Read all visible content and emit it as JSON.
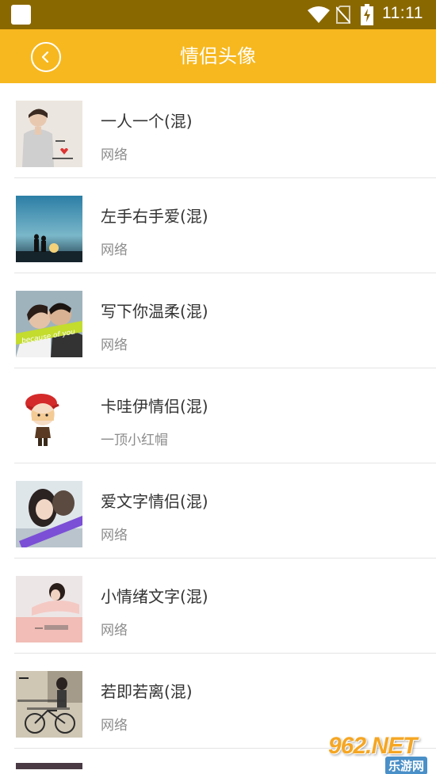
{
  "status_bar": {
    "time": "11:11",
    "icons": [
      "app-notification-icon",
      "wifi-icon",
      "no-sim-icon",
      "battery-charging-icon"
    ]
  },
  "header": {
    "title": "情侣头像",
    "back_icon": "chevron-left-icon",
    "background_color": "#f7b81f"
  },
  "list": {
    "items": [
      {
        "title": "一人一个(混)",
        "subtitle": "网络",
        "thumb": "thumb-boy-portrait"
      },
      {
        "title": "左手右手爱(混)",
        "subtitle": "网络",
        "thumb": "thumb-couple-sunset"
      },
      {
        "title": "写下你温柔(混)",
        "subtitle": "网络",
        "thumb": "thumb-couple-kiss",
        "thumb_text": "because of you"
      },
      {
        "title": "卡哇伊情侣(混)",
        "subtitle": "一顶小红帽",
        "thumb": "thumb-cartoon-red-hat"
      },
      {
        "title": "爱文字情侣(混)",
        "subtitle": "网络",
        "thumb": "thumb-couple-text-banner"
      },
      {
        "title": "小情绪文字(混)",
        "subtitle": "网络",
        "thumb": "thumb-girl-lying"
      },
      {
        "title": "若即若离(混)",
        "subtitle": "网络",
        "thumb": "thumb-bicycle"
      }
    ]
  },
  "watermark": {
    "logo": "962.NET",
    "sub": "乐游网"
  }
}
